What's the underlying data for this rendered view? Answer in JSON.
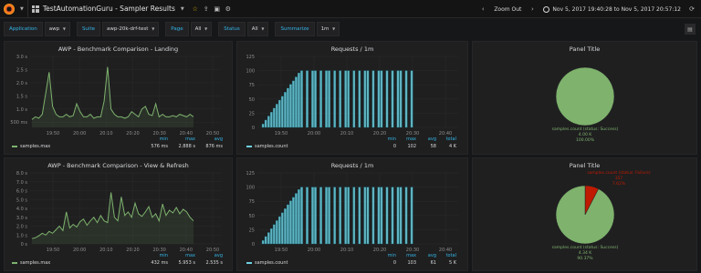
{
  "topbar": {
    "dashboard_title": "TestAutomationGuru - Sampler Results",
    "zoom_label": "Zoom Out",
    "time_range": "Nov 5, 2017 19:40:28 to Nov 5, 2017 20:57:12"
  },
  "variables": [
    {
      "label": "Application",
      "value": "awp"
    },
    {
      "label": "Suite",
      "value": "awp-20k-drf-test"
    },
    {
      "label": "Page",
      "value": "All"
    },
    {
      "label": "Status",
      "value": "All"
    },
    {
      "label": "Summarize",
      "value": "1m"
    }
  ],
  "colors": {
    "series_green": "#7eb26d",
    "series_cyan": "#6ed0e0",
    "pie_red": "#bf1b00",
    "accent": "#33b5e5"
  },
  "panels": {
    "landing": {
      "title": "AWP - Benchmark Comparison - Landing",
      "legend": "samples.max",
      "stats_headers": [
        "min",
        "max",
        "avg"
      ],
      "stats_values": [
        "576 ms",
        "2.888 s",
        "876 ms"
      ]
    },
    "requests1": {
      "title": "Requests / 1m",
      "legend": "samples.count",
      "stats_headers": [
        "min",
        "max",
        "avg",
        "total"
      ],
      "stats_values": [
        "0",
        "102",
        "58",
        "4 K"
      ]
    },
    "pie1": {
      "title": "Panel Title",
      "label_lines": [
        "samples.count (status: Success)",
        "4.00 K",
        "100.00%"
      ]
    },
    "viewrefresh": {
      "title": "AWP - Benchmark Comparison - View & Refresh",
      "legend": "samples.max",
      "stats_headers": [
        "min",
        "max",
        "avg"
      ],
      "stats_values": [
        "432 ms",
        "5.953 s",
        "2.535 s"
      ]
    },
    "requests2": {
      "title": "Requests / 1m",
      "legend": "samples.count",
      "stats_headers": [
        "min",
        "max",
        "avg",
        "total"
      ],
      "stats_values": [
        "0",
        "103",
        "61",
        "5 K"
      ]
    },
    "pie2": {
      "title": "Panel Title",
      "fail_lines": [
        "samples.count (status: Failure)",
        "357",
        "7.62%"
      ],
      "success_lines": [
        "samples.count (status: Success)",
        "4.34 K",
        "90.37%"
      ]
    }
  },
  "chart_data": [
    {
      "type": "line",
      "name": "landing",
      "x_ticks": [
        "19:50",
        "20:00",
        "20:10",
        "20:20",
        "20:30",
        "20:40",
        "20:50"
      ],
      "y_ticks": [
        "500 ms",
        "1.0 s",
        "1.5 s",
        "2.0 s",
        "2.5 s",
        "3.0 s"
      ],
      "ylim": [
        0.3,
        3.0
      ],
      "series": [
        {
          "name": "samples.max",
          "values": [
            0.6,
            0.7,
            0.65,
            0.8,
            1.6,
            2.4,
            1.1,
            0.8,
            0.7,
            0.7,
            0.8,
            0.7,
            0.75,
            1.2,
            0.9,
            0.7,
            0.7,
            0.8,
            0.65,
            0.7,
            0.7,
            1.3,
            2.6,
            1.0,
            0.8,
            0.7,
            0.7,
            0.65,
            0.7,
            0.9,
            0.8,
            0.7,
            1.0,
            1.1,
            0.8,
            0.75,
            1.2,
            0.7,
            0.8,
            0.7,
            0.7,
            0.75,
            0.7,
            0.8,
            0.75,
            0.7,
            0.8,
            0.7
          ]
        }
      ]
    },
    {
      "type": "bar",
      "name": "requests1",
      "x_ticks": [
        "19:50",
        "20:00",
        "20:10",
        "20:20",
        "20:30",
        "20:40"
      ],
      "y_ticks": [
        "0",
        "25",
        "50",
        "75",
        "100",
        "125"
      ],
      "ylim": [
        0,
        125
      ],
      "series": [
        {
          "name": "samples.count",
          "values": [
            0,
            6,
            13,
            20,
            27,
            34,
            41,
            48,
            55,
            62,
            69,
            76,
            82,
            89,
            96,
            100,
            0,
            100,
            0,
            100,
            100,
            0,
            100,
            0,
            100,
            100,
            0,
            100,
            0,
            100,
            0,
            100,
            100,
            0,
            100,
            0,
            100,
            0,
            100,
            100,
            0,
            100,
            0,
            100,
            100,
            0,
            100,
            0,
            100,
            0,
            100,
            100,
            0,
            100,
            0,
            100,
            0,
            0,
            0
          ]
        }
      ]
    },
    {
      "type": "pie",
      "name": "pie1",
      "labels": [
        "samples.count (status: Success)"
      ],
      "values": [
        4000
      ]
    },
    {
      "type": "line",
      "name": "viewrefresh",
      "x_ticks": [
        "19:50",
        "20:00",
        "20:10",
        "20:20",
        "20:30",
        "20:40",
        "20:50"
      ],
      "y_ticks": [
        "0 s",
        "1.0 s",
        "2.0 s",
        "3.0 s",
        "4.0 s",
        "5.0 s",
        "6.0 s",
        "7.0 s",
        "8.0 s"
      ],
      "ylim": [
        0,
        8
      ],
      "series": [
        {
          "name": "samples.max",
          "values": [
            0.6,
            0.7,
            0.9,
            1.2,
            1.0,
            1.4,
            1.2,
            1.6,
            2.0,
            1.5,
            3.6,
            1.8,
            2.2,
            1.9,
            2.5,
            2.8,
            2.1,
            2.6,
            3.0,
            2.4,
            3.2,
            2.6,
            2.4,
            5.8,
            3.0,
            2.6,
            5.3,
            3.2,
            3.6,
            3.0,
            4.6,
            3.4,
            3.1,
            3.6,
            4.2,
            3.0,
            3.4,
            2.6,
            4.5,
            3.2,
            3.8,
            3.5,
            4.1,
            3.4,
            3.9,
            3.6,
            3.0,
            2.6
          ]
        }
      ]
    },
    {
      "type": "bar",
      "name": "requests2",
      "x_ticks": [
        "19:50",
        "20:00",
        "20:10",
        "20:20",
        "20:30",
        "20:40"
      ],
      "y_ticks": [
        "0",
        "25",
        "50",
        "75",
        "100",
        "125"
      ],
      "ylim": [
        0,
        125
      ],
      "series": [
        {
          "name": "samples.count",
          "values": [
            0,
            6,
            13,
            20,
            27,
            34,
            41,
            48,
            55,
            62,
            69,
            76,
            82,
            89,
            96,
            100,
            0,
            100,
            0,
            100,
            100,
            0,
            100,
            0,
            100,
            100,
            0,
            100,
            0,
            100,
            0,
            100,
            100,
            0,
            100,
            0,
            100,
            0,
            100,
            100,
            0,
            100,
            0,
            100,
            100,
            0,
            100,
            0,
            100,
            0,
            100,
            100,
            0,
            100,
            0,
            100,
            0,
            0,
            0
          ]
        }
      ]
    },
    {
      "type": "pie",
      "name": "pie2",
      "labels": [
        "samples.count (status: Failure)",
        "samples.count (status: Success)"
      ],
      "values": [
        357,
        4340
      ]
    }
  ]
}
